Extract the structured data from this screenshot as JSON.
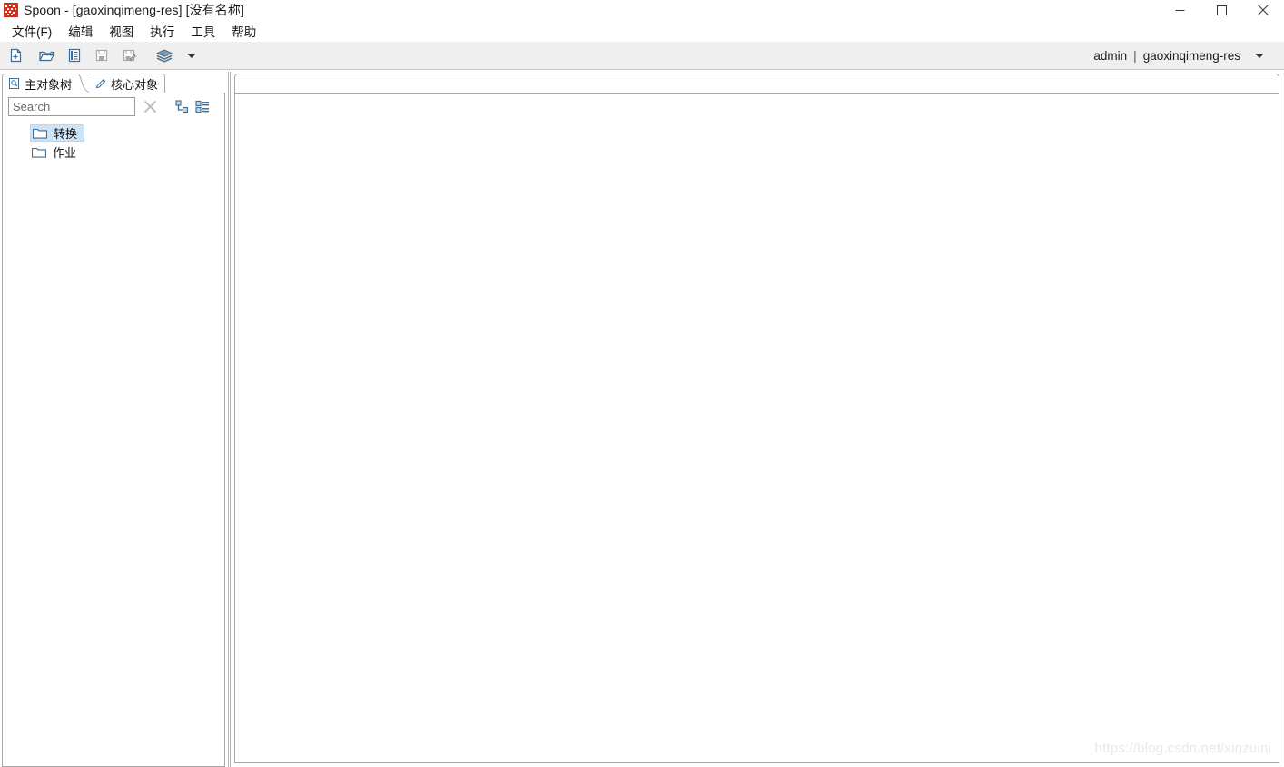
{
  "window": {
    "title": "Spoon - [gaoxinqimeng-res] [没有名称]",
    "app_icon": "spoon-logo-icon",
    "controls": {
      "minimize": "minimize-icon",
      "maximize": "maximize-icon",
      "close": "close-icon"
    }
  },
  "menubar": {
    "items": [
      {
        "label": "文件(F)"
      },
      {
        "label": "编辑"
      },
      {
        "label": "视图"
      },
      {
        "label": "执行"
      },
      {
        "label": "工具"
      },
      {
        "label": "帮助"
      }
    ]
  },
  "toolbar": {
    "buttons": [
      {
        "name": "new-file-icon",
        "enabled": true
      },
      {
        "name": "open-file-icon",
        "enabled": true
      },
      {
        "name": "browse-repository-icon",
        "enabled": true
      },
      {
        "name": "save-icon",
        "enabled": false
      },
      {
        "name": "save-as-icon",
        "enabled": false
      },
      {
        "name": "layers-icon",
        "enabled": true
      }
    ],
    "dropdown_caret": "chevron-down-icon",
    "user": "admin",
    "separator": "|",
    "repository": "gaoxinqimeng-res",
    "user_caret": "chevron-down-icon"
  },
  "left_panel": {
    "tabs": [
      {
        "label": "主对象树",
        "icon": "object-tree-icon",
        "selected": true
      },
      {
        "label": "核心对象",
        "icon": "pencil-icon",
        "selected": false
      }
    ],
    "search": {
      "value": "",
      "placeholder": "Search",
      "clear_icon": "clear-x-icon"
    },
    "view_buttons": [
      {
        "name": "expand-tree-icon"
      },
      {
        "name": "collapse-tree-icon"
      }
    ],
    "tree": [
      {
        "label": "转换",
        "icon": "folder-icon",
        "selected": true
      },
      {
        "label": "作业",
        "icon": "folder-icon",
        "selected": false
      }
    ]
  },
  "main": {
    "tabs": [],
    "canvas_empty": true
  },
  "watermark": {
    "text": "https://blog.csdn.net/xinzuini"
  },
  "colors": {
    "accent_blue": "#3d6d96",
    "selection_blue": "#cde3f7",
    "toolbar_bg": "#efefef",
    "border_gray": "#a7a7a7",
    "logo_red": "#d12b1e"
  }
}
